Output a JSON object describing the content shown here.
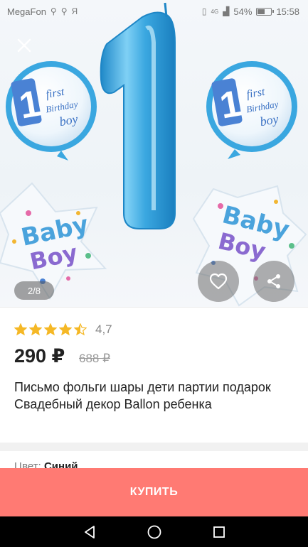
{
  "status_bar": {
    "carrier": "MegaFon",
    "extra": "Я",
    "signal": "4G",
    "battery_percent": "54%",
    "battery_level": 0.54,
    "time": "15:58"
  },
  "gallery": {
    "counter": "2/8",
    "balloon_text": {
      "first": "first",
      "birthday": "Birthday",
      "boy": "boy",
      "one": "1",
      "baby": "Baby",
      "boy_big": "Boy"
    },
    "colors": {
      "foil_blue": "#3aa7e0",
      "foil_light": "#9fd6f4",
      "label_blue": "#4a82d4",
      "purple": "#8a6ad0"
    }
  },
  "product": {
    "rating_value": "4,7",
    "stars": 4.5,
    "price": "290 ₽",
    "old_price": "688 ₽",
    "title": "Письмо фольги шары дети партии подарок Свадебный декор Ballon ребенка",
    "color_label": "Цвет:",
    "color_value": "Синий"
  },
  "actions": {
    "buy_label": "КУПИТЬ",
    "buy_color": "#ff7a73"
  }
}
